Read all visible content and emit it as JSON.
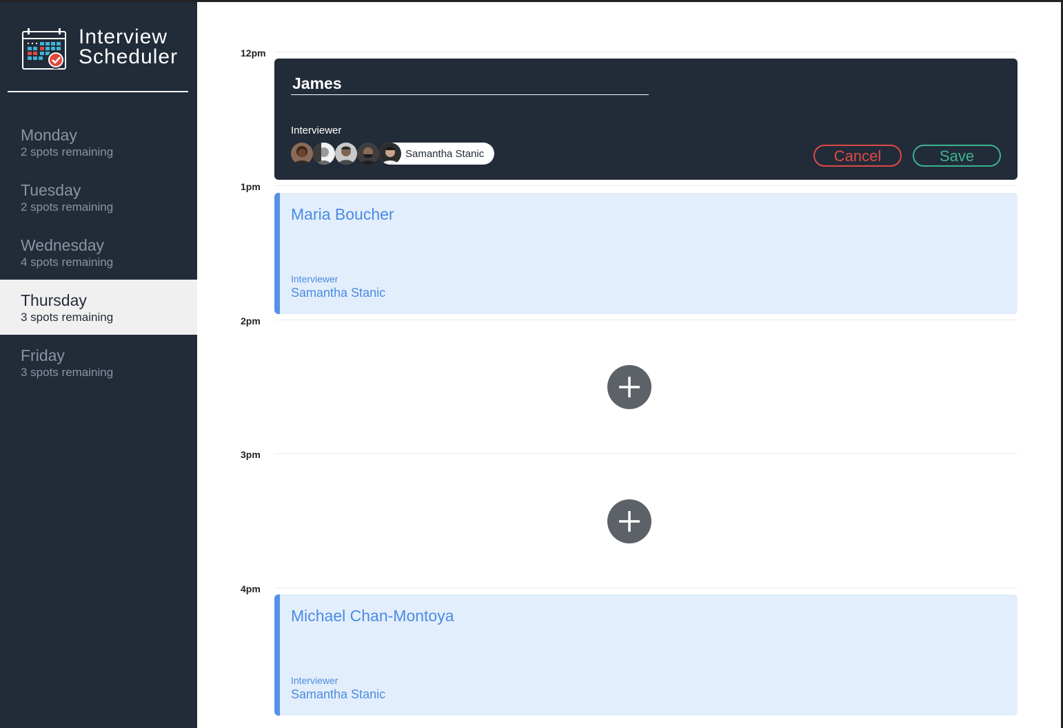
{
  "app": {
    "title_line1": "Interview",
    "title_line2": "Scheduler"
  },
  "sidebar": {
    "days": [
      {
        "name": "Monday",
        "spots": "2 spots remaining",
        "selected": false
      },
      {
        "name": "Tuesday",
        "spots": "2 spots remaining",
        "selected": false
      },
      {
        "name": "Wednesday",
        "spots": "4 spots remaining",
        "selected": false
      },
      {
        "name": "Thursday",
        "spots": "3 spots remaining",
        "selected": true
      },
      {
        "name": "Friday",
        "spots": "3 spots remaining",
        "selected": false
      }
    ]
  },
  "schedule": {
    "hours": [
      "12pm",
      "1pm",
      "2pm",
      "3pm",
      "4pm"
    ],
    "form": {
      "student_value": "James",
      "interviewer_label": "Interviewer",
      "selected_interviewer": "Samantha Stanic",
      "cancel_label": "Cancel",
      "save_label": "Save"
    },
    "appointments": [
      {
        "student": "Maria Boucher",
        "interviewer_label": "Interviewer",
        "interviewer": "Samantha Stanic"
      },
      {
        "student": "Michael Chan-Montoya",
        "interviewer_label": "Interviewer",
        "interviewer": "Samantha Stanic"
      }
    ]
  },
  "colors": {
    "sidebar_bg": "#222b38",
    "appointment_bg": "#e3eefc",
    "appointment_accent": "#5592e6",
    "cancel": "#de4a45",
    "save": "#3bb58f",
    "add_button": "#5d6268"
  },
  "icons": {
    "logo": "calendar-check-icon",
    "add": "plus-icon"
  }
}
